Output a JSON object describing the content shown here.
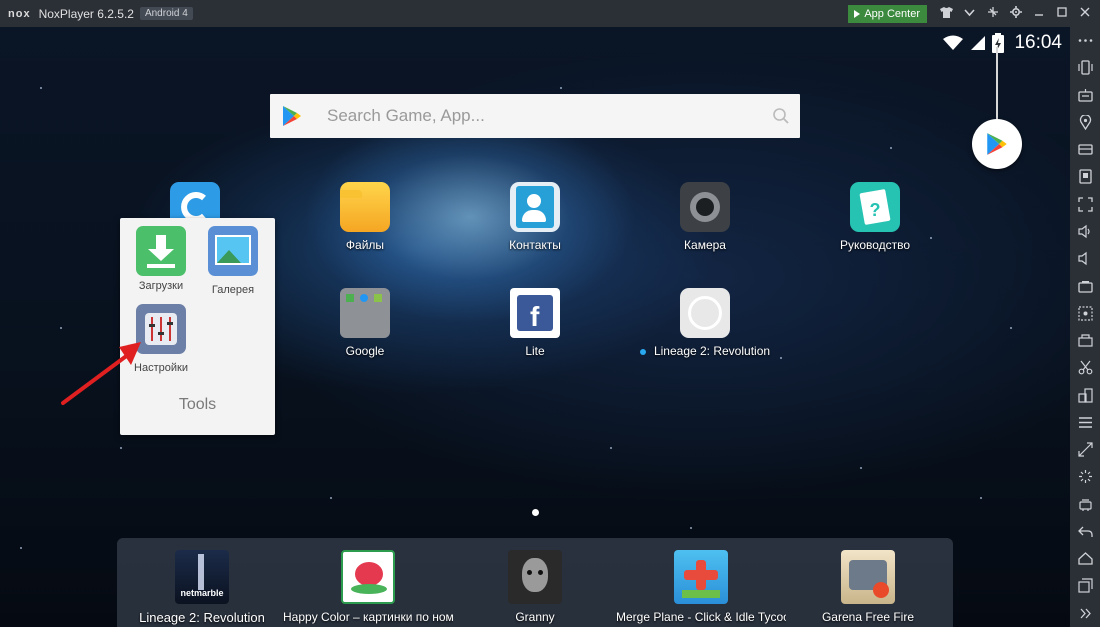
{
  "window": {
    "logo": "nox",
    "title": "NoxPlayer 6.2.5.2",
    "android_badge": "Android 4",
    "app_center_label": "App Center"
  },
  "status_bar": {
    "time": "16:04"
  },
  "search": {
    "placeholder": "Search Game, App..."
  },
  "desktop_apps": [
    {
      "label": "Файлы",
      "icon": "files-icon"
    },
    {
      "label": "Контакты",
      "icon": "contacts-icon"
    },
    {
      "label": "Камера",
      "icon": "camera-icon"
    },
    {
      "label": "Руководство",
      "icon": "guide-icon"
    },
    {
      "label": "Google",
      "icon": "google-folder-icon"
    },
    {
      "label": "Lite",
      "icon": "facebook-lite-icon"
    },
    {
      "label": "Lineage 2: Revolution",
      "icon": "nox-app-icon"
    }
  ],
  "folder": {
    "name": "Tools",
    "apps": [
      {
        "label": "Загрузки",
        "icon": "downloads-icon"
      },
      {
        "label": "Галерея",
        "icon": "gallery-icon"
      },
      {
        "label": "Настройки",
        "icon": "settings-icon"
      }
    ]
  },
  "dock": [
    {
      "label": "Lineage 2: Revolution",
      "icon": "lineage-game-icon"
    },
    {
      "label": "Happy Color – картинки по номер",
      "icon": "happy-color-icon"
    },
    {
      "label": "Granny",
      "icon": "granny-icon"
    },
    {
      "label": "Merge Plane - Click & Idle Tycoon",
      "icon": "merge-plane-icon"
    },
    {
      "label": "Garena Free Fire",
      "icon": "free-fire-icon"
    }
  ],
  "sidebar_icons": [
    "more-icon",
    "phone-shake-icon",
    "keyboard-control-icon",
    "location-icon",
    "virtual-keys-icon",
    "apk-install-icon",
    "fullscreen-icon",
    "volume-up-icon",
    "volume-down-icon",
    "screenshot-icon",
    "macro-icon",
    "record-icon",
    "scissors-icon",
    "multi-instance-icon",
    "menu-icon",
    "resize-icon",
    "loading-icon",
    "boost-icon",
    "back-icon",
    "home-icon",
    "recent-apps-icon",
    "expand-icon"
  ],
  "colors": {
    "titlebar": "#2b2f36",
    "app_center": "#3b8a3e",
    "arrow": "#e02020"
  }
}
